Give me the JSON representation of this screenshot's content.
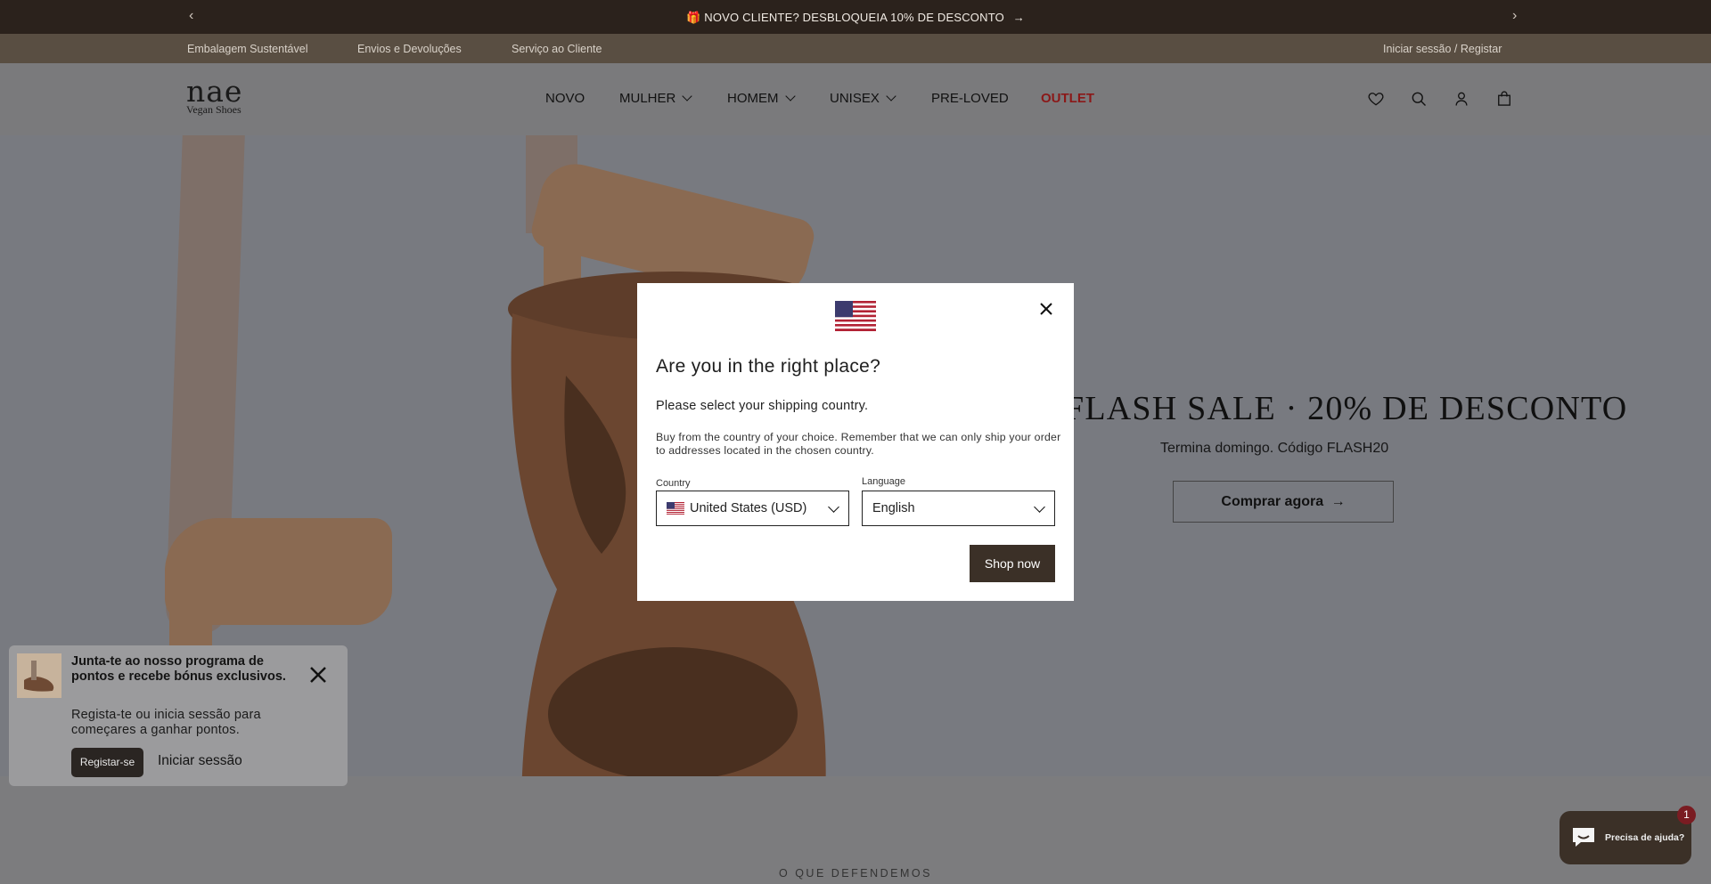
{
  "announcement": {
    "prev_label": "‹",
    "next_label": "›",
    "message": "🎁 NOVO CLIENTE? DESBLOQUEIA 10% DE DESCONTO",
    "arrow": "→"
  },
  "utility_bar": {
    "links": [
      "Embalagem Sustentável",
      "Envios e Devoluções",
      "Serviço ao Cliente"
    ],
    "account": "Iniciar sessão / Registar"
  },
  "header": {
    "logo_main": "nae",
    "logo_sub": "Vegan Shoes",
    "nav": [
      {
        "label": "NOVO"
      },
      {
        "label": "MULHER"
      },
      {
        "label": "HOMEM"
      },
      {
        "label": "UNISEX"
      },
      {
        "label": "PRE-LOVED"
      },
      {
        "label": "OUTLET"
      }
    ],
    "icons": [
      "heart-icon",
      "search-icon",
      "user-icon",
      "bag-icon"
    ]
  },
  "hero": {
    "title": "FLASH SALE · 20% DE DESCONTO",
    "subtitle": "Termina domingo. Código FLASH20",
    "cta": "Comprar agora",
    "cta_arrow": "→"
  },
  "section": {
    "heading": "O QUE DEFENDEMOS"
  },
  "modal": {
    "heading": "Are you in the right place?",
    "select_text": "Please select your shipping country.",
    "info": "Buy from the country of your choice. Remember that we can only ship your order to addresses located in the chosen country.",
    "country_label": "Country",
    "country_value": "United States (USD)",
    "language_label": "Language",
    "language_value": "English",
    "shop_button": "Shop now"
  },
  "rewards": {
    "title": "Junta-te ao nosso programa de pontos e recebe bónus exclusivos.",
    "body": "Regista-te ou inicia sessão para começares a ganhar pontos.",
    "register": "Registar-se",
    "login": "Iniciar sessão"
  },
  "chat": {
    "label": "Precisa de ajuda?",
    "badge": "1"
  }
}
